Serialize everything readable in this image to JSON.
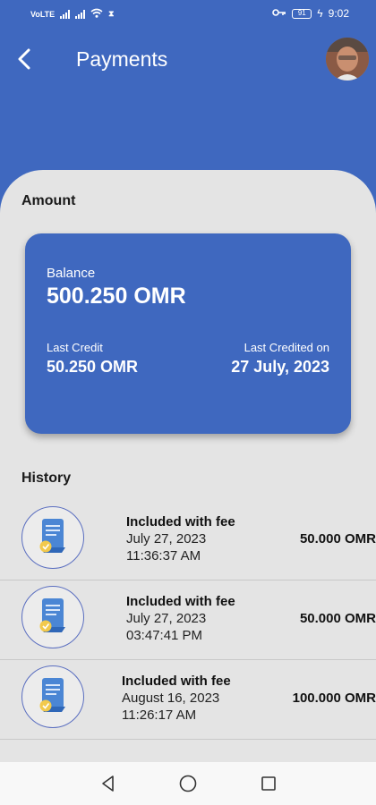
{
  "status_bar": {
    "time": "9:02",
    "battery": "91",
    "left_indicators": [
      "VoLTE",
      "4G",
      "4G",
      "wifi",
      "hourglass"
    ]
  },
  "header": {
    "title": "Payments",
    "back_icon": "back-arrow-icon",
    "avatar_icon": "user-avatar"
  },
  "amount_section": {
    "label": "Amount",
    "card": {
      "balance_label": "Balance",
      "balance_value": "500.250 OMR",
      "last_credit_label": "Last Credit",
      "last_credit_value": "50.250 OMR",
      "last_credited_on_label": "Last Credited on",
      "last_credited_on_value": "27 July, 2023"
    }
  },
  "history_section": {
    "label": "History",
    "items": [
      {
        "title": "Included with fee",
        "date": "July 27, 2023",
        "time": "11:36:37 AM",
        "amount": "50.000 OMR"
      },
      {
        "title": "Included with fee",
        "date": "July 27, 2023",
        "time": "03:47:41 PM",
        "amount": "50.000 OMR"
      },
      {
        "title": "Included with fee",
        "date": "August 16, 2023",
        "time": "11:26:17 AM",
        "amount": "100.000 OMR"
      }
    ]
  },
  "nav_bar": {
    "back": "triangle-back-icon",
    "home": "circle-home-icon",
    "recents": "square-recents-icon"
  },
  "colors": {
    "primary": "#3f68bf",
    "sheet": "#e4e4e4",
    "icon_ring": "#5a6ec0",
    "receipt": "#4b86d4",
    "badge": "#f2c94c"
  }
}
